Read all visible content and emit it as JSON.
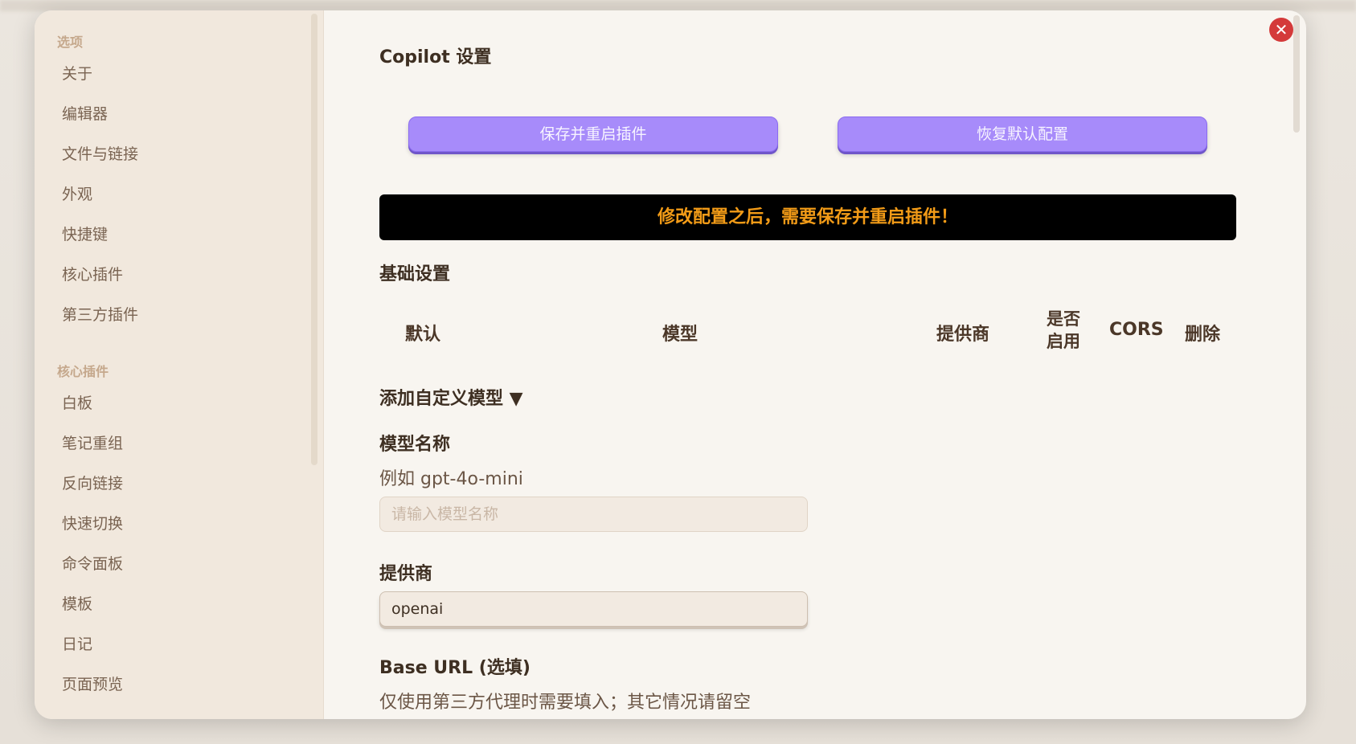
{
  "sidebar": {
    "group_options": "选项",
    "options_items": [
      {
        "label": "关于"
      },
      {
        "label": "编辑器"
      },
      {
        "label": "文件与链接"
      },
      {
        "label": "外观"
      },
      {
        "label": "快捷键"
      },
      {
        "label": "核心插件"
      },
      {
        "label": "第三方插件"
      }
    ],
    "group_core": "核心插件",
    "core_items": [
      {
        "label": "白板"
      },
      {
        "label": "笔记重组"
      },
      {
        "label": "反向链接"
      },
      {
        "label": "快速切换"
      },
      {
        "label": "命令面板"
      },
      {
        "label": "模板"
      },
      {
        "label": "日记"
      },
      {
        "label": "页面预览"
      }
    ]
  },
  "content": {
    "title": "Copilot 设置",
    "save_button": "保存并重启插件",
    "reset_button": "恢复默认配置",
    "warning": "修改配置之后，需要保存并重启插件！",
    "basic_settings": "基础设置",
    "table_headers": {
      "default": "默认",
      "model": "模型",
      "provider": "提供商",
      "enabled_line1": "是否",
      "enabled_line2": "启用",
      "cors": "CORS",
      "delete": "删除"
    },
    "custom_model_summary": "添加自定义模型 ▼",
    "model_name_label": "模型名称",
    "model_name_desc": "例如 gpt-4o-mini",
    "model_name_placeholder": "请输入模型名称",
    "provider_label": "提供商",
    "provider_value": "openai",
    "base_url_label": "Base URL (选填)",
    "base_url_desc": "仅使用第三方代理时需要填入；其它情况请留空"
  },
  "colors": {
    "accent_purple": "#a78bfa",
    "warning_text": "#f29b17",
    "close_red": "#d43a3a"
  }
}
